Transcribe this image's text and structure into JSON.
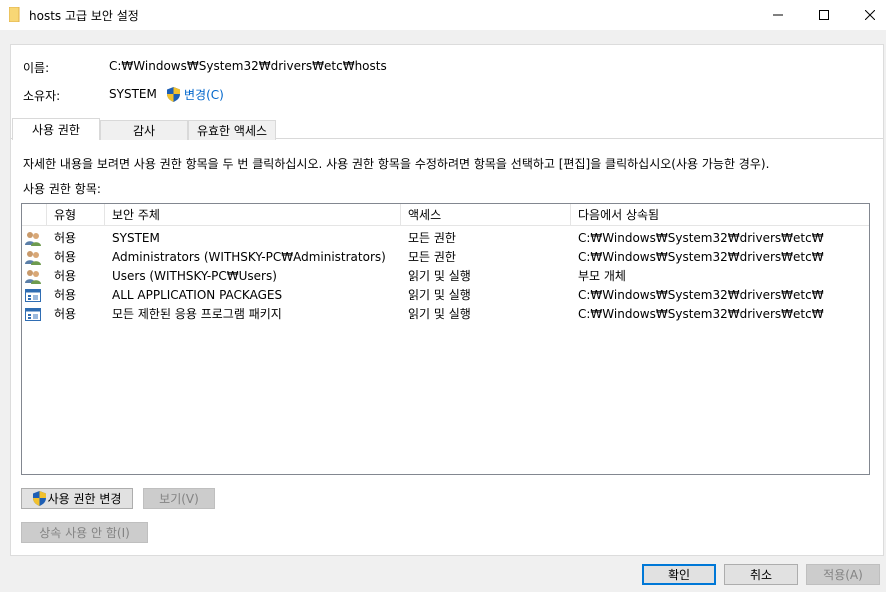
{
  "window": {
    "title": "hosts 고급 보안 설정",
    "icons": {
      "app": "folder-icon",
      "minimize": "minimize-icon",
      "maximize": "maximize-icon",
      "close": "close-icon"
    }
  },
  "details": {
    "name_label": "이름:",
    "name_value": "C:₩Windows₩System32₩drivers₩etc₩hosts",
    "owner_label": "소유자:",
    "owner_value": "SYSTEM",
    "change_link": "변경(C)"
  },
  "tabs": [
    {
      "label": "사용 권한",
      "active": true
    },
    {
      "label": "감사",
      "active": false
    },
    {
      "label": "유효한 액세스",
      "active": false
    }
  ],
  "description": "자세한 내용을 보려면 사용 권한 항목을 두 번 클릭하십시오. 사용 권한 항목을 수정하려면 항목을 선택하고 [편집]을 클릭하십시오(사용 가능한 경우).",
  "list_label": "사용 권한 항목:",
  "columns": [
    "유형",
    "보안 주체",
    "액세스",
    "다음에서 상속됨"
  ],
  "entries": [
    {
      "icon": "users-icon",
      "type": "허용",
      "principal": "SYSTEM",
      "access": "모든 권한",
      "inherited_from": "C:₩Windows₩System32₩drivers₩etc₩"
    },
    {
      "icon": "users-icon",
      "type": "허용",
      "principal": "Administrators (WITHSKY-PC₩Administrators)",
      "access": "모든 권한",
      "inherited_from": "C:₩Windows₩System32₩drivers₩etc₩"
    },
    {
      "icon": "users-icon",
      "type": "허용",
      "principal": "Users (WITHSKY-PC₩Users)",
      "access": "읽기 및 실행",
      "inherited_from": "부모 개체"
    },
    {
      "icon": "app-package-icon",
      "type": "허용",
      "principal": "ALL APPLICATION PACKAGES",
      "access": "읽기 및 실행",
      "inherited_from": "C:₩Windows₩System32₩drivers₩etc₩"
    },
    {
      "icon": "app-package-icon",
      "type": "허용",
      "principal": "모든 제한된 응용 프로그램 패키지",
      "access": "읽기 및 실행",
      "inherited_from": "C:₩Windows₩System32₩drivers₩etc₩"
    }
  ],
  "buttons": {
    "change_permissions": "사용 권한 변경",
    "view": "보기(V)",
    "disable_inheritance": "상속 사용 안 함(I)",
    "ok": "확인",
    "cancel": "취소",
    "apply": "적용(A)"
  },
  "colors": {
    "link": "#0066cc",
    "shield_blue": "#1e5fb4",
    "shield_yellow": "#f2c12e"
  }
}
